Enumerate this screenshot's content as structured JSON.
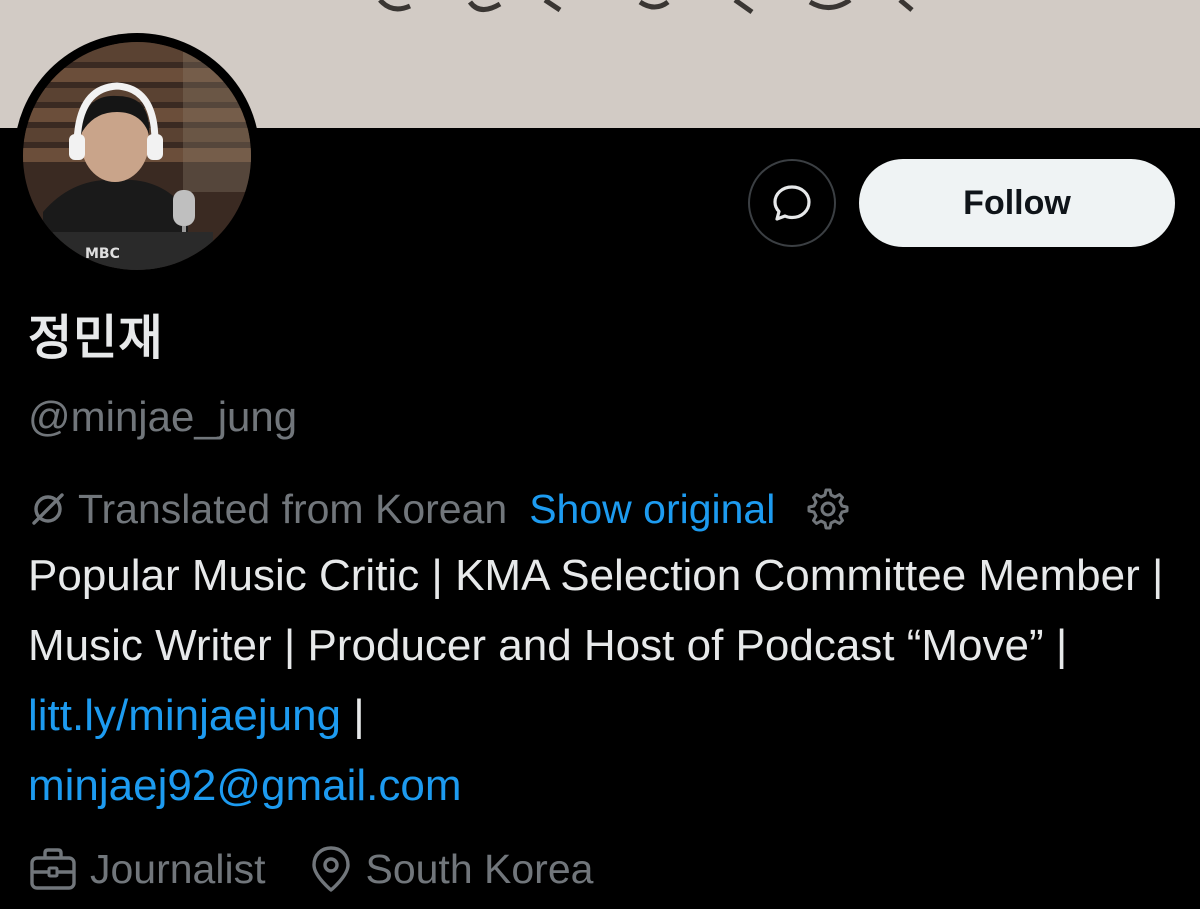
{
  "profile": {
    "display_name": "정민재",
    "handle": "@minjae_jung",
    "follow_label": "Follow",
    "translation": {
      "notice": "Translated from Korean",
      "show_original": "Show original"
    },
    "bio": {
      "text": "Popular Music Critic | KMA Selection Committee Member | Music Writer | Producer and Host of Podcast “Move” | ",
      "link": "litt.ly/minjaejung",
      "separator": " |",
      "email": "minjaej92@gmail.com"
    },
    "meta": {
      "profession": "Journalist",
      "location": "South Korea"
    },
    "avatar_logo": "MBC"
  },
  "icons": {
    "message": "message-bubble-icon",
    "no_translation": "no-slash-icon",
    "settings": "gear-icon",
    "briefcase": "briefcase-icon",
    "location": "location-pin-icon"
  },
  "colors": {
    "background": "#000000",
    "text_primary": "#e7e9ea",
    "text_muted": "#71767b",
    "link": "#1d9bf0",
    "follow_bg": "#eff3f4",
    "follow_text": "#0f1419"
  }
}
